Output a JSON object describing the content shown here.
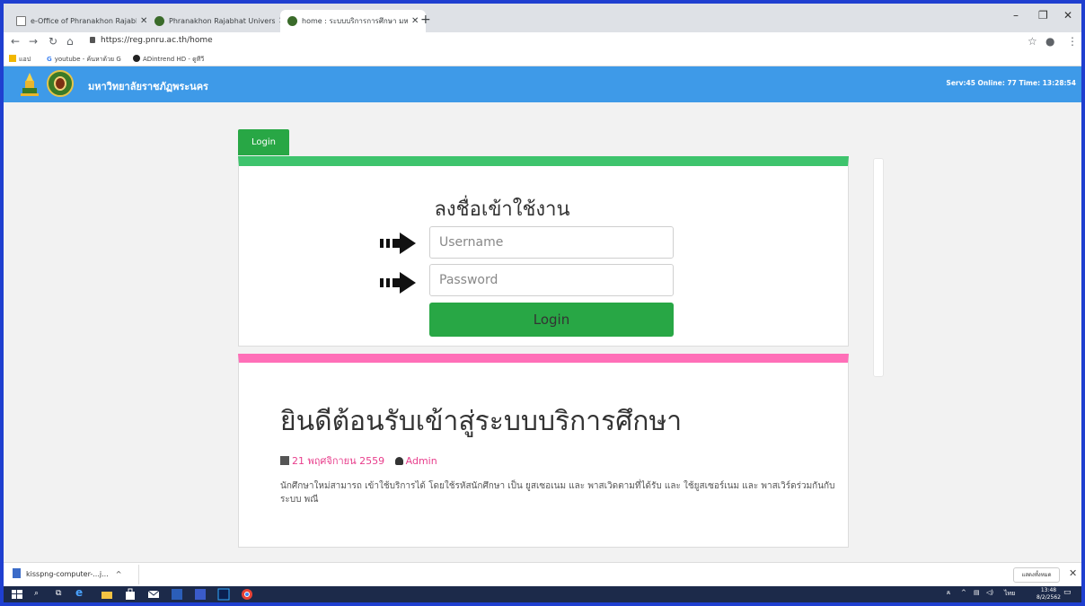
{
  "browser": {
    "tabs": [
      {
        "label": "e-Office of Phranakhon Rajabha",
        "active": false
      },
      {
        "label": "Phranakhon Rajabhat University",
        "active": false
      },
      {
        "label": "home : ระบบบริการการศึกษา มหาวิท",
        "active": true
      }
    ],
    "url": "https://reg.pnru.ac.th/home",
    "bookmarks": [
      "แอป",
      "youtube - ค้นหาด้วย G",
      "ADintrend HD - ดูทีวี"
    ]
  },
  "site": {
    "university_name": "มหาวิทยาลัยราชภัฏพระนคร",
    "server_status": "Serv:45 Online: 77 Time: 13:28:54"
  },
  "login": {
    "tab_label": "Login",
    "title": "ลงชื่อเข้าใช้งาน",
    "username_placeholder": "Username",
    "password_placeholder": "Password",
    "button_label": "Login"
  },
  "announcement": {
    "title": "ยินดีต้อนรับเข้าสู่ระบบบริการศึกษา",
    "date": "21 พฤศจิกายน 2559",
    "author": "Admin",
    "body": "นักศึกษาใหม่สามารถ เข้าใช้บริการได้ โดยใช้รหัสนักศึกษา เป็น ยูสเซอเนม และ พาสเวิดตามที่ได้รับ และ ใช้ยูสเซอร์เนม และ พาสเวิร์ดร่วมกันกับ ระบบ พณี"
  },
  "downloads": {
    "file": "kisspng-computer-...j...",
    "show_all": "แสดงทั้งหมด"
  },
  "taskbar": {
    "time": "13:48",
    "date": "8/2/2562",
    "lang": "ไทย"
  },
  "colors": {
    "header_blue": "#3e9ae8",
    "green": "#28a745",
    "pink": "#ff6fb8"
  }
}
